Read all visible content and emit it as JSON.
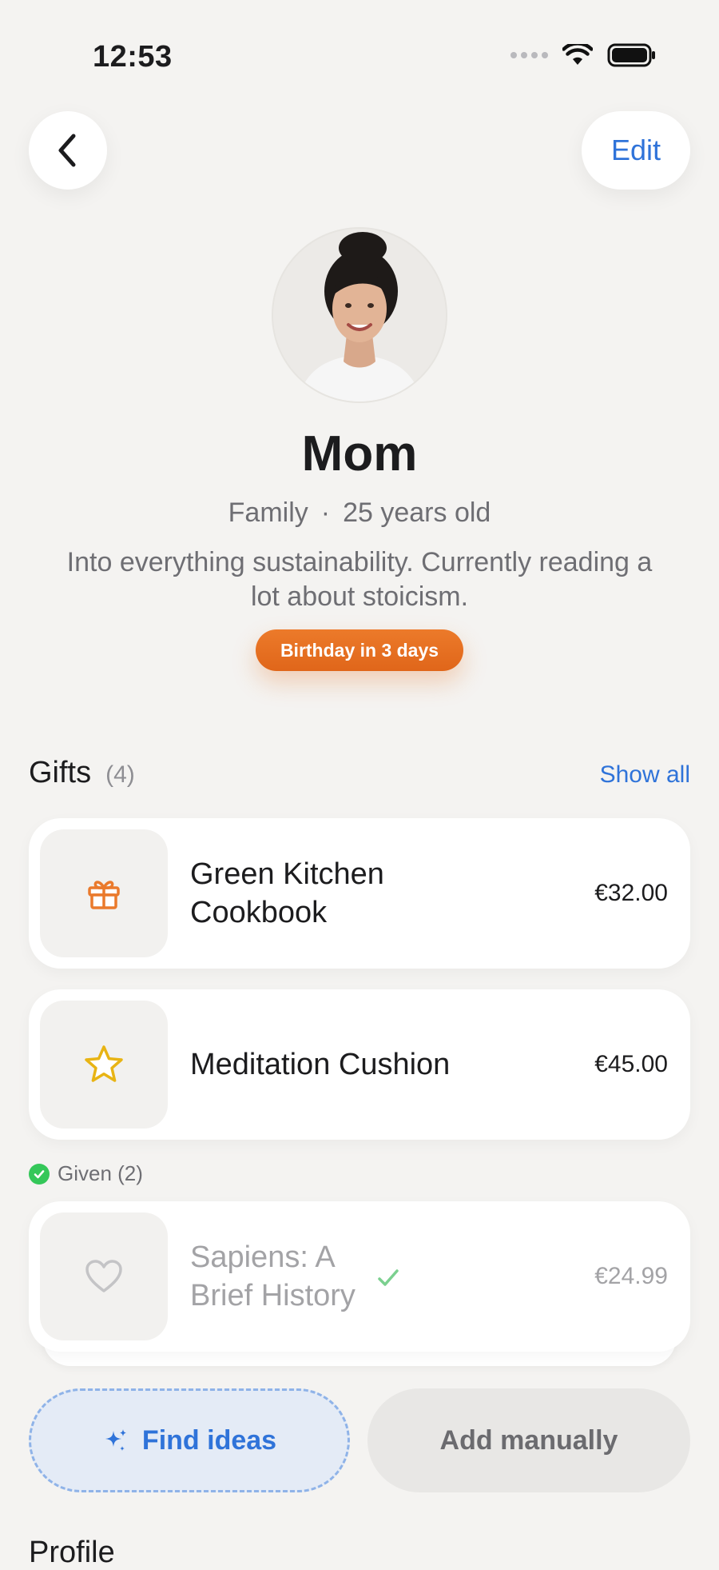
{
  "status_bar": {
    "time": "12:53"
  },
  "nav": {
    "edit_label": "Edit"
  },
  "profile": {
    "name": "Mom",
    "relation": "Family",
    "separator": "·",
    "age": "25 years old",
    "bio": "Into everything sustainability. Currently reading a lot about stoicism.",
    "badge": "Birthday in 3 days"
  },
  "gifts": {
    "title": "Gifts",
    "count": "(4)",
    "show_all": "Show all",
    "items": [
      {
        "title": "Green Kitchen Cookbook",
        "price": "€32.00",
        "icon": "gift-icon"
      },
      {
        "title": "Meditation Cushion",
        "price": "€45.00",
        "icon": "star-icon"
      }
    ],
    "given_label": "Given (2)",
    "given_items": [
      {
        "title": "Sapiens: A Brief History",
        "price": "€24.99",
        "icon": "heart-icon"
      }
    ]
  },
  "actions": {
    "find_ideas": "Find ideas",
    "add_manually": "Add manually"
  },
  "sections": {
    "profile_title": "Profile"
  },
  "colors": {
    "accent": "#2f73d9",
    "badge": "#e8701f",
    "given_check": "#34c759",
    "background": "#f4f3f1"
  }
}
